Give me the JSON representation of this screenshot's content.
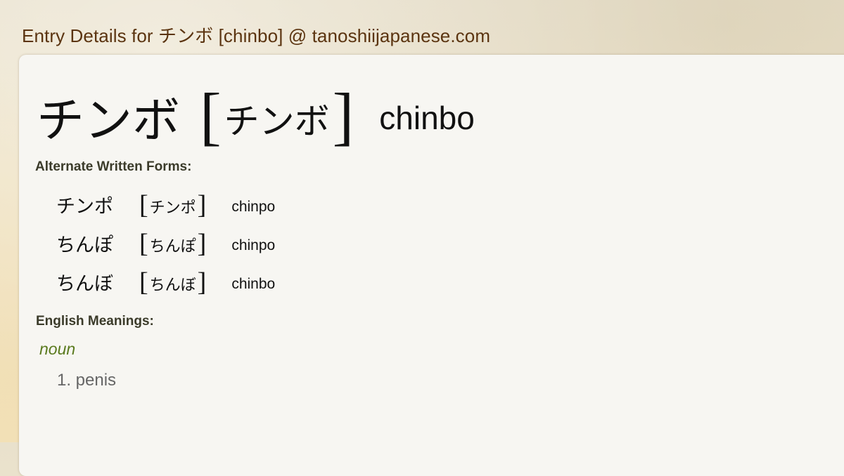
{
  "page": {
    "title": "Entry Details for チンボ [chinbo] @ tanoshiijapanese.com"
  },
  "entry": {
    "kanji": "チンボ",
    "bracket_open": "[",
    "reading": "チンボ",
    "bracket_close": "]",
    "romaji": "chinbo"
  },
  "alternate_forms": {
    "label": "Alternate Written Forms:",
    "items": [
      {
        "kanji": "チンポ",
        "reading": "チンポ",
        "romaji": "chinpo"
      },
      {
        "kanji": "ちんぽ",
        "reading": "ちんぽ",
        "romaji": "chinpo"
      },
      {
        "kanji": "ちんぼ",
        "reading": "ちんぼ",
        "romaji": "chinbo"
      }
    ]
  },
  "meanings": {
    "label": "English Meanings:",
    "part_of_speech": "noun",
    "items": [
      {
        "text": "1. penis"
      }
    ]
  },
  "colors": {
    "title": "#5b3410",
    "part_of_speech": "#5a7a1e",
    "section_label": "#3b3b2a",
    "meaning_text": "#666666",
    "panel_bg": "#f7f6f2"
  }
}
